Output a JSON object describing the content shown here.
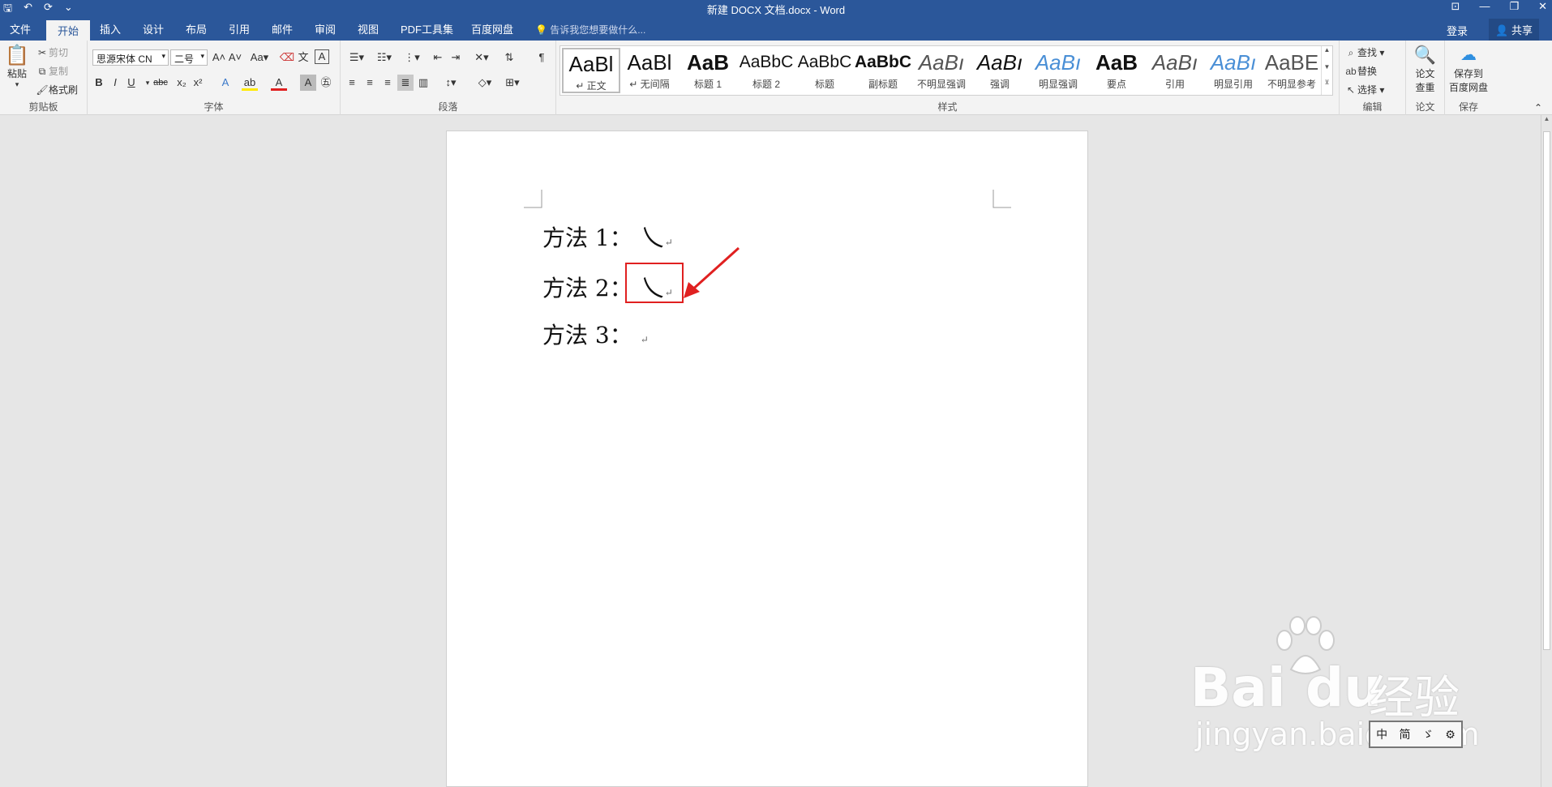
{
  "titlebar": {
    "title": "新建 DOCX 文档.docx - Word",
    "qat": {
      "save": "🖫",
      "undo": "↶",
      "redo": "⟳",
      "more": "⌄"
    },
    "winctl": {
      "ribbon_opt": "⊡",
      "minimize": "—",
      "restore": "❐",
      "close": "✕"
    }
  },
  "tabs": [
    "文件",
    "开始",
    "插入",
    "设计",
    "布局",
    "引用",
    "邮件",
    "审阅",
    "视图",
    "PDF工具集",
    "百度网盘"
  ],
  "tell_me": "告诉我您想要做什么...",
  "login": "登录",
  "share": "共享",
  "clipboard": {
    "paste": "粘贴",
    "cut": "剪切",
    "copy": "复制",
    "format_painter": "格式刷",
    "label": "剪贴板"
  },
  "font": {
    "name": "思源宋体 CN",
    "size": "二号",
    "label": "字体"
  },
  "paragraph": {
    "label": "段落"
  },
  "styles": {
    "label": "样式",
    "items": [
      {
        "sample": "AaBl",
        "name": "↵ 正文"
      },
      {
        "sample": "AaBl",
        "name": "↵ 无间隔"
      },
      {
        "sample": "AaB",
        "name": "标题 1"
      },
      {
        "sample": "AaBbC",
        "name": "标题 2"
      },
      {
        "sample": "AaBbC",
        "name": "标题"
      },
      {
        "sample": "AaBbC",
        "name": "副标题"
      },
      {
        "sample": "AaBı",
        "name": "不明显强调"
      },
      {
        "sample": "AaBı",
        "name": "强调"
      },
      {
        "sample": "AaBı",
        "name": "明显强调"
      },
      {
        "sample": "AaB",
        "name": "要点"
      },
      {
        "sample": "AaBı",
        "name": "引用"
      },
      {
        "sample": "AaBı",
        "name": "明显引用"
      },
      {
        "sample": "AaBE",
        "name": "不明显参考"
      }
    ]
  },
  "editing": {
    "find": "查找",
    "replace": "替换",
    "select": "选择",
    "label": "编辑"
  },
  "paper": {
    "check_l1": "论文",
    "check_l2": "查重",
    "label": "论文"
  },
  "save": {
    "save_l1": "保存到",
    "save_l2": "百度网盘",
    "label": "保存"
  },
  "document": {
    "lines": [
      {
        "label": "方法 1：",
        "glyph": "乀",
        "mark": "↵"
      },
      {
        "label": "方法 2：",
        "glyph": "乀",
        "mark": "↵"
      },
      {
        "label": "方法 3：",
        "glyph": "",
        "mark": "↵"
      }
    ]
  },
  "watermark": {
    "brand": "Bai",
    "brand2": "du",
    "jingyan": "经验",
    "url": "jingyan.baidu.com"
  },
  "ime": {
    "c1": "中",
    "c2": "简",
    "c3": "ゞ",
    "c4": "⚙"
  },
  "colors": {
    "accent": "#2b579a",
    "highlight": "#e02020"
  }
}
